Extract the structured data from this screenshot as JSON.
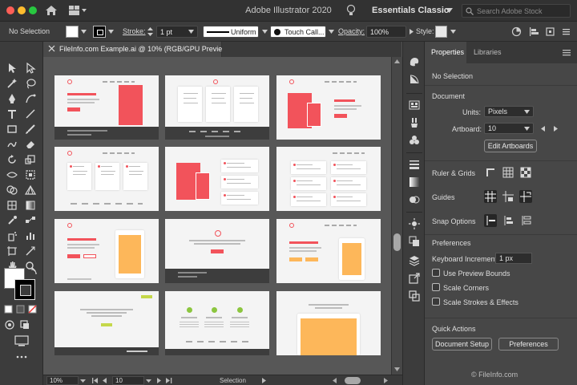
{
  "window": {
    "title": "Adobe Illustrator 2020",
    "workspace": "Essentials Classic",
    "search_placeholder": "Search Adobe Stock"
  },
  "control_bar": {
    "selection": "No Selection",
    "stroke_label": "Stroke:",
    "stroke_weight": "1 pt",
    "profile": "Uniform",
    "brush": "Touch Call...",
    "opacity_label": "Opacity:",
    "opacity_value": "100%",
    "style_label": "Style:"
  },
  "document": {
    "tab_title": "FileInfo.com Example.ai @ 10% (RGB/GPU Preview)",
    "artboard_count": 12
  },
  "status_bar": {
    "zoom": "10%",
    "artboard": "10",
    "mode": "Selection"
  },
  "properties": {
    "tabs": [
      {
        "label": "Properties",
        "active": true
      },
      {
        "label": "Libraries",
        "active": false
      }
    ],
    "selection": "No Selection",
    "document_heading": "Document",
    "units_label": "Units:",
    "units_value": "Pixels",
    "artboard_label": "Artboard:",
    "artboard_value": "10",
    "edit_artboards": "Edit Artboards",
    "rulers_grids": "Ruler & Grids",
    "guides": "Guides",
    "snap_options": "Snap Options",
    "preferences_heading": "Preferences",
    "keyboard_increment_label": "Keyboard Increment:",
    "keyboard_increment_value": "1 px",
    "checkboxes": [
      {
        "label": "Use Preview Bounds",
        "checked": false
      },
      {
        "label": "Scale Corners",
        "checked": false
      },
      {
        "label": "Scale Strokes & Effects",
        "checked": false
      }
    ],
    "quick_actions_heading": "Quick Actions",
    "document_setup": "Document Setup",
    "preferences_button": "Preferences"
  },
  "watermark": "© FileInfo.com",
  "colors": {
    "accent_red": "#f2535b",
    "accent_orange": "#fdb75a",
    "accent_green": "#8cc63f"
  }
}
